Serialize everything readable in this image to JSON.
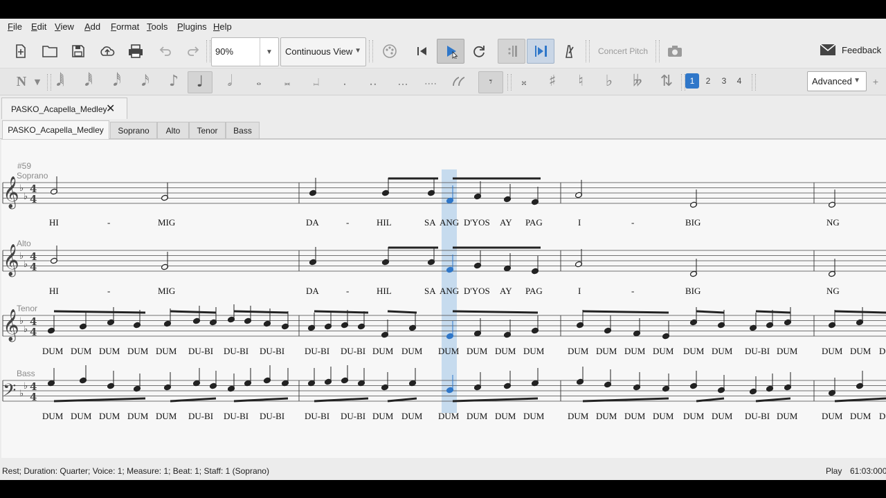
{
  "menu": [
    "File",
    "Edit",
    "View",
    "Add",
    "Format",
    "Tools",
    "Plugins",
    "Help"
  ],
  "toolbar": {
    "zoom_value": "90%",
    "view_mode": "Continuous View",
    "concert_pitch": "Concert Pitch",
    "feedback": "Feedback",
    "workspace": "Advanced",
    "voices": [
      "1",
      "2",
      "3",
      "4"
    ]
  },
  "document_tab": "PASKO_Acapella_Medley",
  "part_tabs": [
    "PASKO_Acapella_Medley",
    "Soprano",
    "Alto",
    "Tenor",
    "Bass"
  ],
  "score": {
    "measure_number": "#59",
    "staves": [
      {
        "name": "Soprano",
        "lyrics": [
          "HI",
          "-",
          "MIG",
          "DA",
          "-",
          "HIL",
          "SA",
          "ANG",
          "D'YOS",
          "AY",
          "PAG",
          "I",
          "-",
          "BIG",
          "NG"
        ]
      },
      {
        "name": "Alto",
        "lyrics": [
          "HI",
          "-",
          "MIG",
          "DA",
          "-",
          "HIL",
          "SA",
          "ANG",
          "D'YOS",
          "AY",
          "PAG",
          "I",
          "-",
          "BIG",
          "NG"
        ]
      },
      {
        "name": "Tenor",
        "lyrics": [
          "DUM",
          "DUM",
          "DUM",
          "DUM",
          "DUM",
          "DU-BI",
          "DU-BI",
          "DU-BI",
          "DU-BI",
          "DU-BI",
          "DUM",
          "DUM",
          "DUM",
          "DUM",
          "DUM",
          "DUM",
          "DUM",
          "DUM",
          "DUM",
          "DUM",
          "DUM",
          "DUM",
          "DU-BI",
          "DUM",
          "DUM",
          "DUM",
          "D"
        ]
      },
      {
        "name": "Bass",
        "lyrics": [
          "DUM",
          "DUM",
          "DUM",
          "DUM",
          "DUM",
          "DU-BI",
          "DU-BI",
          "DU-BI",
          "DU-BI",
          "DU-BI",
          "DUM",
          "DUM",
          "DUM",
          "DUM",
          "DUM",
          "DUM",
          "DUM",
          "DUM",
          "DUM",
          "DUM",
          "DUM",
          "DUM",
          "DU-BI",
          "DUM",
          "DUM",
          "DUM",
          "D"
        ]
      }
    ]
  },
  "status": {
    "message": "Rest; Duration: Quarter; Voice: 1;  Measure: 1; Beat: 1; Staff: 1 (Soprano)",
    "mode": "Play",
    "time": "61:03:000"
  },
  "colors": {
    "accent": "#2f77c9",
    "selection": "#c6dbee",
    "background": "#ececec"
  }
}
